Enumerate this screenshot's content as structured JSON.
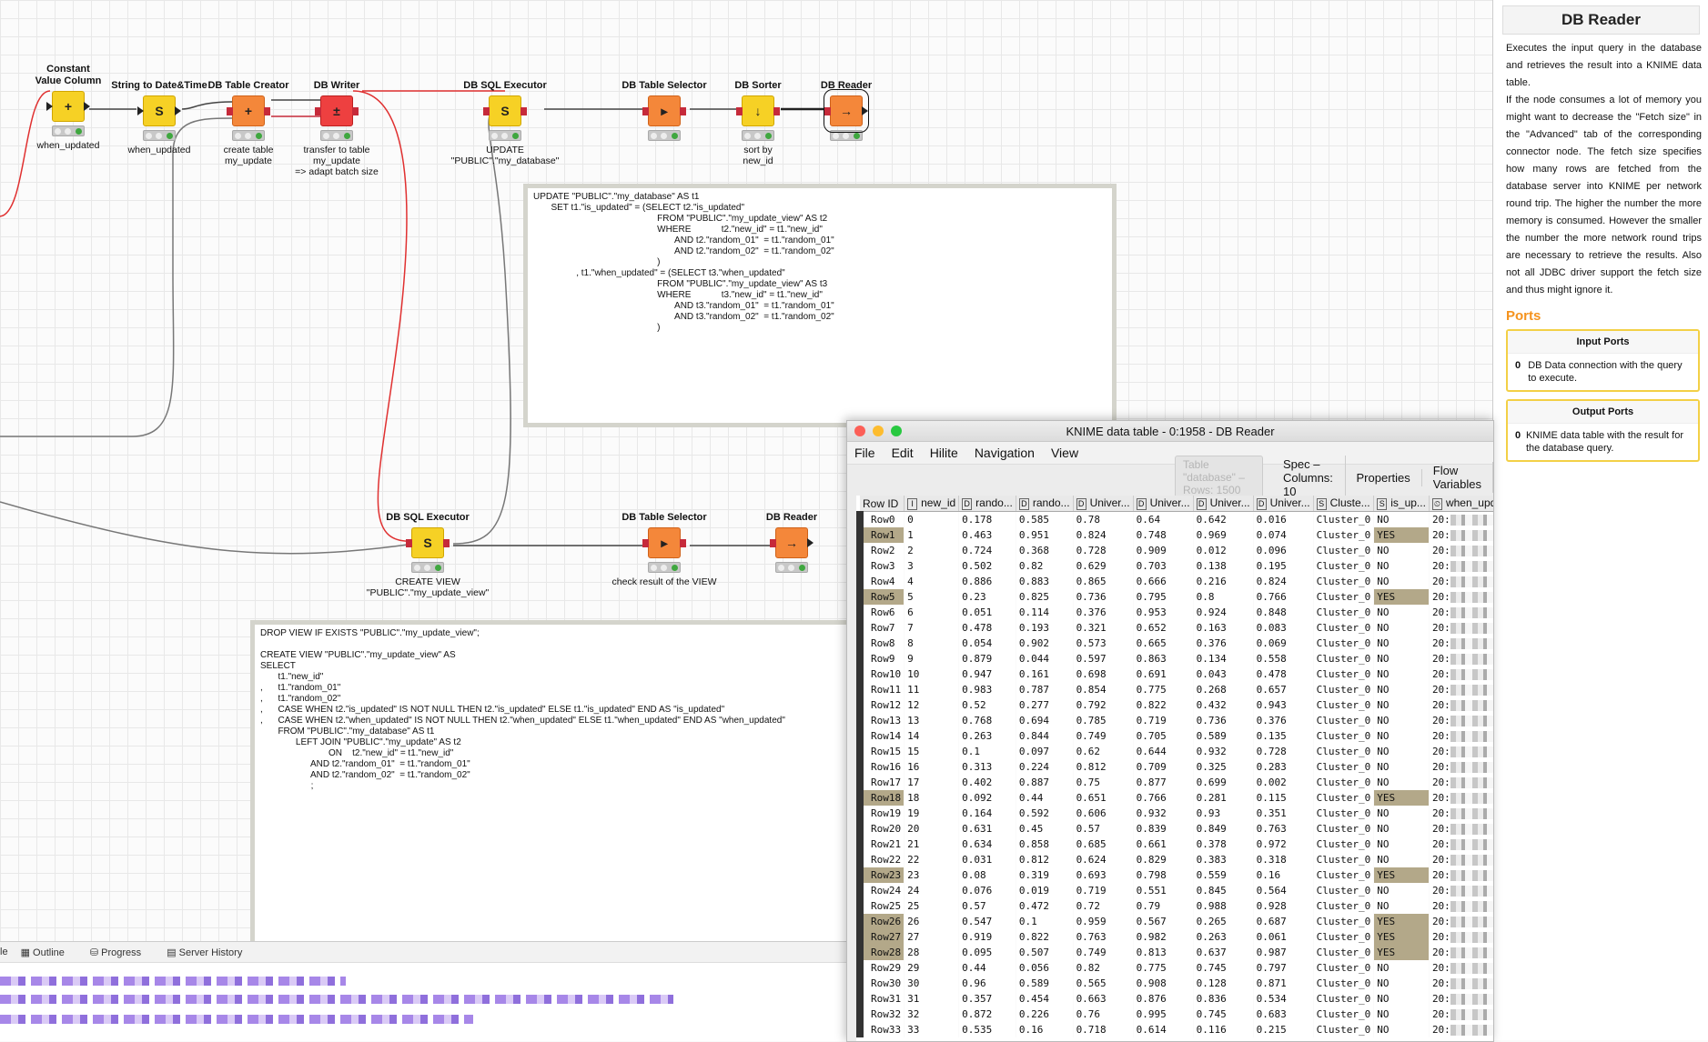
{
  "workflow": {
    "nodes": [
      {
        "id": "n1",
        "title": "Constant\nValue Column",
        "label": "when_updated",
        "color": "yellow",
        "icon": "+"
      },
      {
        "id": "n2",
        "title": "String to Date&Time",
        "label": "when_updated",
        "color": "yellow",
        "icon": "S"
      },
      {
        "id": "n3",
        "title": "DB Table Creator",
        "label": "create table\nmy_update",
        "color": "orange",
        "icon": "+"
      },
      {
        "id": "n4",
        "title": "DB Writer",
        "label": "transfer to table\nmy_update\n=> adapt batch size",
        "color": "red",
        "icon": "±"
      },
      {
        "id": "n5",
        "title": "DB SQL Executor",
        "label": "UPDATE \"PUBLIC\".\"my_database\"",
        "color": "yellow",
        "icon": "S"
      },
      {
        "id": "n6",
        "title": "DB Table Selector",
        "label": "",
        "color": "orange",
        "icon": "▸"
      },
      {
        "id": "n7",
        "title": "DB Sorter",
        "label": "sort by\nnew_id",
        "color": "yellow",
        "icon": "↓"
      },
      {
        "id": "n8",
        "title": "DB Reader",
        "label": "",
        "color": "orange",
        "icon": "→"
      },
      {
        "id": "n9",
        "title": "DB SQL Executor",
        "label": "CREATE VIEW \"PUBLIC\".\"my_update_view\"",
        "color": "yellow",
        "icon": "S"
      },
      {
        "id": "n10",
        "title": "DB Table Selector",
        "label": "check result of the VIEW",
        "color": "orange",
        "icon": "▸"
      },
      {
        "id": "n11",
        "title": "DB Reader",
        "label": "",
        "color": "orange",
        "icon": "→"
      }
    ],
    "annotation_update": "UPDATE \"PUBLIC\".\"my_database\" AS t1\n       SET t1.\"is_updated\" = (SELECT t2.\"is_updated\"\n                                                 FROM \"PUBLIC\".\"my_update_view\" AS t2\n                                                 WHERE            t2.\"new_id\" = t1.\"new_id\"\n                                                        AND t2.\"random_01\"  = t1.\"random_01\"\n                                                        AND t2.\"random_02\"  = t1.\"random_02\"\n                                                 )\n                 , t1.\"when_updated\" = (SELECT t3.\"when_updated\"\n                                                 FROM \"PUBLIC\".\"my_update_view\" AS t3\n                                                 WHERE            t3.\"new_id\" = t1.\"new_id\"\n                                                        AND t3.\"random_01\"  = t1.\"random_01\"\n                                                        AND t3.\"random_02\"  = t1.\"random_02\"\n                                                 )",
    "annotation_view": "DROP VIEW IF EXISTS \"PUBLIC\".\"my_update_view\";\n\nCREATE VIEW \"PUBLIC\".\"my_update_view\" AS\nSELECT\n       t1.\"new_id\"\n,      t1.\"random_01\"\n,      t1.\"random_02\"\n,      CASE WHEN t2.\"is_updated\" IS NOT NULL THEN t2.\"is_updated\" ELSE t1.\"is_updated\" END AS \"is_updated\"\n,      CASE WHEN t2.\"when_updated\" IS NOT NULL THEN t2.\"when_updated\" ELSE t1.\"when_updated\" END AS \"when_updated\"\n       FROM \"PUBLIC\".\"my_database\" AS t1\n              LEFT JOIN \"PUBLIC\".\"my_update\" AS t2\n                           ON    t2.\"new_id\" = t1.\"new_id\"\n                    AND t2.\"random_01\"  = t1.\"random_01\"\n                    AND t2.\"random_02\"  = t1.\"random_02\"\n                    ;"
  },
  "description": {
    "title": "DB Reader",
    "text": "Executes the input query in the database and retrieves the result into a KNIME data table.\nIf the node consumes a lot of memory you might want to decrease the \"Fetch size\" in the \"Advanced\" tab of the corresponding connector node. The fetch size specifies how many rows are fetched from the database server into KNIME per network round trip. The higher the number the more memory is consumed. However the smaller the number the more network round trips are necessary to retrieve the results. Also not all JDBC driver support the fetch size and thus might ignore it.",
    "ports_heading": "Ports",
    "input_ports_title": "Input Ports",
    "input_port": {
      "num": "0",
      "text": "DB Data connection with the query to execute."
    },
    "output_ports_title": "Output Ports",
    "output_port": {
      "num": "0",
      "text": "KNIME data table with the result for the database query."
    }
  },
  "table_window": {
    "title": "KNIME data table - 0:1958 - DB Reader",
    "menu": [
      "File",
      "Edit",
      "Hilite",
      "Navigation",
      "View"
    ],
    "table_info": "Table \"database\" – Rows: 1500",
    "tabs": [
      "Spec – Columns: 10",
      "Properties",
      "Flow Variables"
    ],
    "columns": [
      {
        "type": "",
        "name": "Row ID"
      },
      {
        "type": "I",
        "name": "new_id"
      },
      {
        "type": "D",
        "name": "rando..."
      },
      {
        "type": "D",
        "name": "rando..."
      },
      {
        "type": "D",
        "name": "Univer..."
      },
      {
        "type": "D",
        "name": "Univer..."
      },
      {
        "type": "D",
        "name": "Univer..."
      },
      {
        "type": "D",
        "name": "Univer..."
      },
      {
        "type": "S",
        "name": "Cluste..."
      },
      {
        "type": "S",
        "name": "is_up..."
      },
      {
        "type": "⏲",
        "name": "when_updated"
      }
    ],
    "rows": [
      [
        "Row0",
        "0",
        "0.178",
        "0.585",
        "0.78",
        "0.64",
        "0.642",
        "0.016",
        "Cluster_0",
        "NO",
        "20:",
        "24:44"
      ],
      [
        "Row1",
        "1",
        "0.463",
        "0.951",
        "0.824",
        "0.748",
        "0.969",
        "0.074",
        "Cluster_0",
        "YES",
        "20:",
        "25"
      ],
      [
        "Row2",
        "2",
        "0.724",
        "0.368",
        "0.728",
        "0.909",
        "0.012",
        "0.096",
        "Cluster_0",
        "NO",
        "20:",
        "24:44"
      ],
      [
        "Row3",
        "3",
        "0.502",
        "0.82",
        "0.629",
        "0.703",
        "0.138",
        "0.195",
        "Cluster_0",
        "NO",
        "20:",
        "24:44"
      ],
      [
        "Row4",
        "4",
        "0.886",
        "0.883",
        "0.865",
        "0.666",
        "0.216",
        "0.824",
        "Cluster_0",
        "NO",
        "20:",
        "24:44"
      ],
      [
        "Row5",
        "5",
        "0.23",
        "0.825",
        "0.736",
        "0.795",
        "0.8",
        "0.766",
        "Cluster_0",
        "YES",
        "20:",
        "25"
      ],
      [
        "Row6",
        "6",
        "0.051",
        "0.114",
        "0.376",
        "0.953",
        "0.924",
        "0.848",
        "Cluster_0",
        "NO",
        "20:",
        "24:44"
      ],
      [
        "Row7",
        "7",
        "0.478",
        "0.193",
        "0.321",
        "0.652",
        "0.163",
        "0.083",
        "Cluster_0",
        "NO",
        "20:",
        "24:44"
      ],
      [
        "Row8",
        "8",
        "0.054",
        "0.902",
        "0.573",
        "0.665",
        "0.376",
        "0.069",
        "Cluster_0",
        "NO",
        "20:",
        "24:44"
      ],
      [
        "Row9",
        "9",
        "0.879",
        "0.044",
        "0.597",
        "0.863",
        "0.134",
        "0.558",
        "Cluster_0",
        "NO",
        "20:",
        "24:44"
      ],
      [
        "Row10",
        "10",
        "0.947",
        "0.161",
        "0.698",
        "0.691",
        "0.043",
        "0.478",
        "Cluster_0",
        "NO",
        "20:",
        "24:44"
      ],
      [
        "Row11",
        "11",
        "0.983",
        "0.787",
        "0.854",
        "0.775",
        "0.268",
        "0.657",
        "Cluster_0",
        "NO",
        "20:",
        "24:44"
      ],
      [
        "Row12",
        "12",
        "0.52",
        "0.277",
        "0.792",
        "0.822",
        "0.432",
        "0.943",
        "Cluster_0",
        "NO",
        "20:",
        "24:44"
      ],
      [
        "Row13",
        "13",
        "0.768",
        "0.694",
        "0.785",
        "0.719",
        "0.736",
        "0.376",
        "Cluster_0",
        "NO",
        "20:",
        "24:44"
      ],
      [
        "Row14",
        "14",
        "0.263",
        "0.844",
        "0.749",
        "0.705",
        "0.589",
        "0.135",
        "Cluster_0",
        "NO",
        "20:",
        "24:44"
      ],
      [
        "Row15",
        "15",
        "0.1",
        "0.097",
        "0.62",
        "0.644",
        "0.932",
        "0.728",
        "Cluster_0",
        "NO",
        "20:",
        "24:44"
      ],
      [
        "Row16",
        "16",
        "0.313",
        "0.224",
        "0.812",
        "0.709",
        "0.325",
        "0.283",
        "Cluster_0",
        "NO",
        "20:",
        "24:44"
      ],
      [
        "Row17",
        "17",
        "0.402",
        "0.887",
        "0.75",
        "0.877",
        "0.699",
        "0.002",
        "Cluster_0",
        "NO",
        "20:",
        "24:44"
      ],
      [
        "Row18",
        "18",
        "0.092",
        "0.44",
        "0.651",
        "0.766",
        "0.281",
        "0.115",
        "Cluster_0",
        "YES",
        "20:",
        "25"
      ],
      [
        "Row19",
        "19",
        "0.164",
        "0.592",
        "0.606",
        "0.932",
        "0.93",
        "0.351",
        "Cluster_0",
        "NO",
        "20:",
        "24:44"
      ],
      [
        "Row20",
        "20",
        "0.631",
        "0.45",
        "0.57",
        "0.839",
        "0.849",
        "0.763",
        "Cluster_0",
        "NO",
        "20:",
        "24:44"
      ],
      [
        "Row21",
        "21",
        "0.634",
        "0.858",
        "0.685",
        "0.661",
        "0.378",
        "0.972",
        "Cluster_0",
        "NO",
        "20:",
        "24:44"
      ],
      [
        "Row22",
        "22",
        "0.031",
        "0.812",
        "0.624",
        "0.829",
        "0.383",
        "0.318",
        "Cluster_0",
        "NO",
        "20:",
        "24:44"
      ],
      [
        "Row23",
        "23",
        "0.08",
        "0.319",
        "0.693",
        "0.798",
        "0.559",
        "0.16",
        "Cluster_0",
        "YES",
        "20:",
        "25"
      ],
      [
        "Row24",
        "24",
        "0.076",
        "0.019",
        "0.719",
        "0.551",
        "0.845",
        "0.564",
        "Cluster_0",
        "NO",
        "20:",
        "24:44"
      ],
      [
        "Row25",
        "25",
        "0.57",
        "0.472",
        "0.72",
        "0.79",
        "0.988",
        "0.928",
        "Cluster_0",
        "NO",
        "20:",
        "24:44"
      ],
      [
        "Row26",
        "26",
        "0.547",
        "0.1",
        "0.959",
        "0.567",
        "0.265",
        "0.687",
        "Cluster_0",
        "YES",
        "20:",
        "25"
      ],
      [
        "Row27",
        "27",
        "0.919",
        "0.822",
        "0.763",
        "0.982",
        "0.263",
        "0.061",
        "Cluster_0",
        "YES",
        "20:",
        "25"
      ],
      [
        "Row28",
        "28",
        "0.095",
        "0.507",
        "0.749",
        "0.813",
        "0.637",
        "0.987",
        "Cluster_0",
        "YES",
        "20:",
        "25"
      ],
      [
        "Row29",
        "29",
        "0.44",
        "0.056",
        "0.82",
        "0.775",
        "0.745",
        "0.797",
        "Cluster_0",
        "NO",
        "20:",
        "24:44"
      ],
      [
        "Row30",
        "30",
        "0.96",
        "0.589",
        "0.565",
        "0.908",
        "0.128",
        "0.871",
        "Cluster_0",
        "NO",
        "20:",
        "24:44"
      ],
      [
        "Row31",
        "31",
        "0.357",
        "0.454",
        "0.663",
        "0.876",
        "0.836",
        "0.534",
        "Cluster_0",
        "NO",
        "20:",
        "24:44"
      ],
      [
        "Row32",
        "32",
        "0.872",
        "0.226",
        "0.76",
        "0.995",
        "0.745",
        "0.683",
        "Cluster_0",
        "NO",
        "20:",
        "24:44"
      ],
      [
        "Row33",
        "33",
        "0.535",
        "0.16",
        "0.718",
        "0.614",
        "0.116",
        "0.215",
        "Cluster_0",
        "NO",
        "20:",
        "24:44"
      ]
    ]
  },
  "console": {
    "tabs": [
      "le",
      "Outline",
      "Progress",
      "Server History"
    ]
  },
  "colors": {
    "yellow": "#f6d125",
    "orange": "#f4873a",
    "red": "#ee4040",
    "highlight": "#b3a889"
  }
}
